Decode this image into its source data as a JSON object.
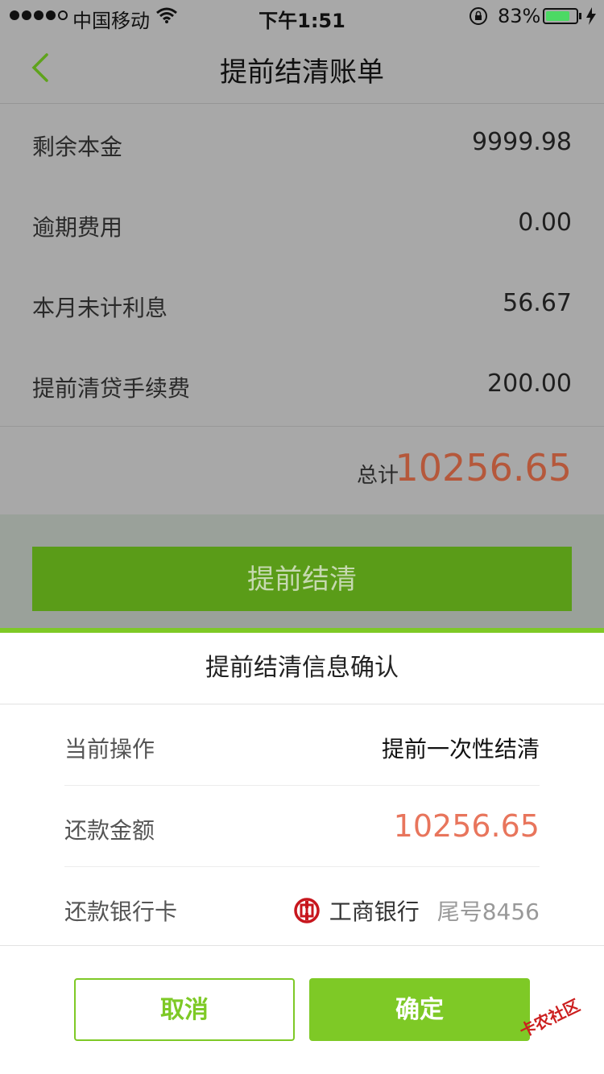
{
  "status_bar": {
    "carrier": "中国移动",
    "time": "下午1:51",
    "battery": "83%",
    "battery_level": 0.83
  },
  "nav": {
    "title": "提前结清账单"
  },
  "bill": {
    "rows": [
      {
        "label": "剩余本金",
        "value": "9999.98"
      },
      {
        "label": "逾期费用",
        "value": "0.00"
      },
      {
        "label": "本月未计利息",
        "value": "56.67"
      },
      {
        "label": "提前清贷手续费",
        "value": "200.00"
      }
    ],
    "total_label": "总计",
    "total_value": "10256.65",
    "button_label": "提前结清"
  },
  "sheet": {
    "title": "提前结清信息确认",
    "operation_label": "当前操作",
    "operation_value": "提前一次性结清",
    "amount_label": "还款金额",
    "amount_value": "10256.65",
    "card_label": "还款银行卡",
    "bank_name": "工商银行",
    "card_tail": "尾号8456",
    "cancel_label": "取消",
    "confirm_label": "确定"
  },
  "watermark": "卡农社区",
  "colors": {
    "accent_green": "#7ec926",
    "dimmed_green": "#5a9c18",
    "amount_red": "#e8755c",
    "overlay_gray": "#a8a8a8"
  },
  "icons": [
    "wifi-icon",
    "orientation-lock-icon",
    "battery-icon",
    "charging-icon",
    "back-chevron-icon",
    "icbc-logo-icon"
  ]
}
